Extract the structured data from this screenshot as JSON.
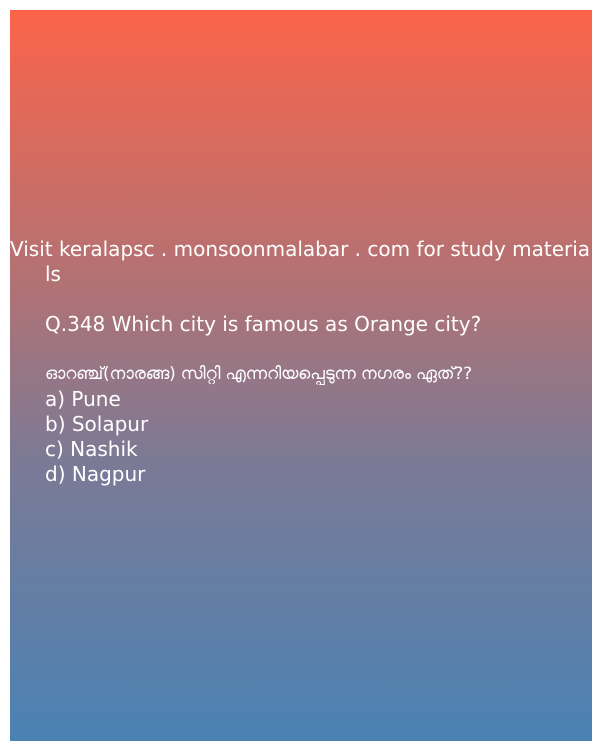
{
  "promo": {
    "line1": "Visit keralapsc . monsoonmalabar . com for study materia",
    "line2": "ls"
  },
  "question": {
    "english": "Q.348 Which city is famous as Orange city?",
    "malayalam": "ഓറഞ്ച്(നാരങ്ങ)  സിറ്റി എന്നറിയപ്പെടുന്ന നഗരം ഏത്??",
    "options": [
      "a) Pune",
      "b) Solapur",
      "c) Nashik",
      "d) Nagpur"
    ]
  },
  "colors": {
    "gradient_top": "#fc644a",
    "gradient_bottom": "#4a82b4",
    "text": "#ffffff"
  }
}
